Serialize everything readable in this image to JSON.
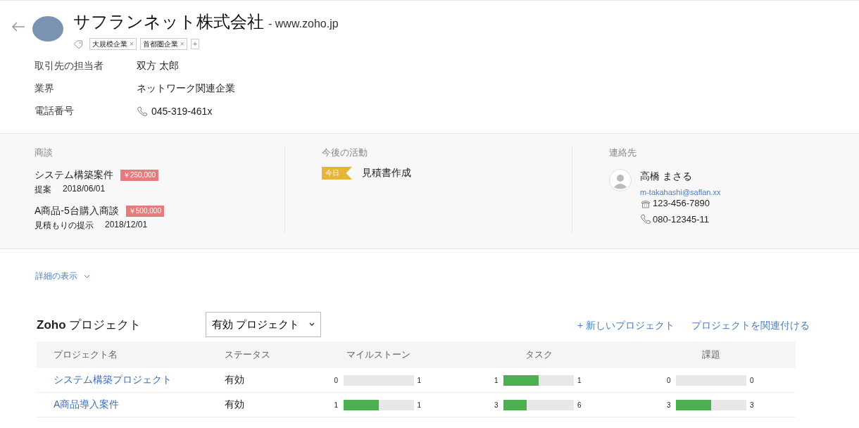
{
  "header": {
    "company": "サフランネット株式会社",
    "website": "- www.zoho.jp",
    "tags": [
      {
        "label": "大規模企業",
        "remove": "×"
      },
      {
        "label": "首都圏企業",
        "remove": "×"
      }
    ],
    "add_tag": "+"
  },
  "fields": [
    {
      "label": "取引先の担当者",
      "value": "双方 太郎",
      "kind": "text"
    },
    {
      "label": "業界",
      "value": "ネットワーク関連企業",
      "kind": "text"
    },
    {
      "label": "電話番号",
      "value": "045-319-461x",
      "kind": "phone"
    }
  ],
  "deals": {
    "title": "商談",
    "items": [
      {
        "name": "システム構築案件",
        "amount": "￥250,000",
        "stage": "提案",
        "date": "2018/06/01"
      },
      {
        "name": "A商品-5台購入商談",
        "amount": "￥500,000",
        "stage": "見積もりの提示",
        "date": "2018/12/01"
      }
    ]
  },
  "activities": {
    "title": "今後の活動",
    "items": [
      {
        "badge": "今日",
        "name": "見積書作成"
      }
    ]
  },
  "contacts": {
    "title": "連絡先",
    "items": [
      {
        "name": "高橋 まさる",
        "email": "m-takahashi@saflan.xx",
        "phones": [
          {
            "kind": "landline",
            "number": "123-456-7890"
          },
          {
            "kind": "mobile",
            "number": "080-12345-11"
          }
        ]
      }
    ]
  },
  "details_link": "詳細の表示",
  "projects": {
    "title_bold": "Zoho",
    "title": "プロジェクト",
    "filter": "有効 プロジェクト",
    "new_link": "+ 新しいプロジェクト",
    "associate_link": "プロジェクトを関連付ける",
    "columns": [
      "プロジェクト名",
      "ステータス",
      "マイルストーン",
      "タスク",
      "課題"
    ],
    "rows": [
      {
        "name": "システム構築プロジェクト",
        "status": "有効",
        "meters": [
          {
            "done": "0",
            "total": "1",
            "level": 0
          },
          {
            "done": "1",
            "total": "1",
            "level": 0.5
          },
          {
            "done": "0",
            "total": "0",
            "level": 0
          }
        ]
      },
      {
        "name": "A商品導入案件",
        "status": "有効",
        "meters": [
          {
            "done": "1",
            "total": "1",
            "level": 0.5
          },
          {
            "done": "3",
            "total": "6",
            "level": 0.33
          },
          {
            "done": "3",
            "total": "3",
            "level": 0.5
          }
        ]
      }
    ]
  }
}
